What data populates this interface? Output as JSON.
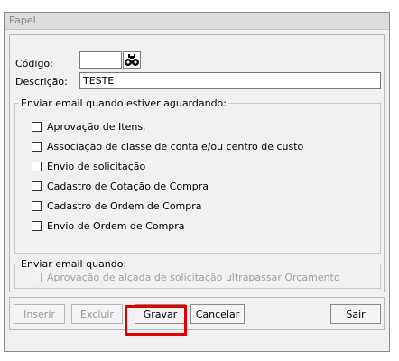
{
  "window": {
    "title": "Papel"
  },
  "form": {
    "codigo_label": "Código:",
    "codigo_value": "",
    "descricao_label": "Descrição:",
    "descricao_value": "TESTE"
  },
  "group_aguardando": {
    "legend": "Enviar email quando estiver aguardando:",
    "items": [
      {
        "label": "Aprovação de Itens.",
        "checked": false
      },
      {
        "label": "Associação de classe de conta e/ou centro de custo",
        "checked": false
      },
      {
        "label": "Envio de solicitação",
        "checked": false
      },
      {
        "label": "Cadastro de Cotação de Compra",
        "checked": false
      },
      {
        "label": "Cadastro de Ordem de Compra",
        "checked": false
      },
      {
        "label": "Envio de Ordem de Compra",
        "checked": false
      }
    ]
  },
  "group_quando": {
    "legend": "Enviar email quando:",
    "items": [
      {
        "label": "Aprovação de alçada de solicitação ultrapassar Orçamento",
        "checked": false,
        "disabled": true
      }
    ]
  },
  "buttons": {
    "inserir": {
      "first": "I",
      "rest": "nserir",
      "enabled": false
    },
    "excluir": {
      "first": "E",
      "rest": "xcluir",
      "enabled": false
    },
    "gravar": {
      "first": "G",
      "rest": "ravar",
      "enabled": true
    },
    "cancelar": {
      "first": "C",
      "rest": "ancelar",
      "enabled": true
    },
    "sair": {
      "label": "Sair",
      "enabled": true
    }
  },
  "icons": {
    "search": "binoculars-icon"
  },
  "colors": {
    "highlight": "#e00000"
  }
}
